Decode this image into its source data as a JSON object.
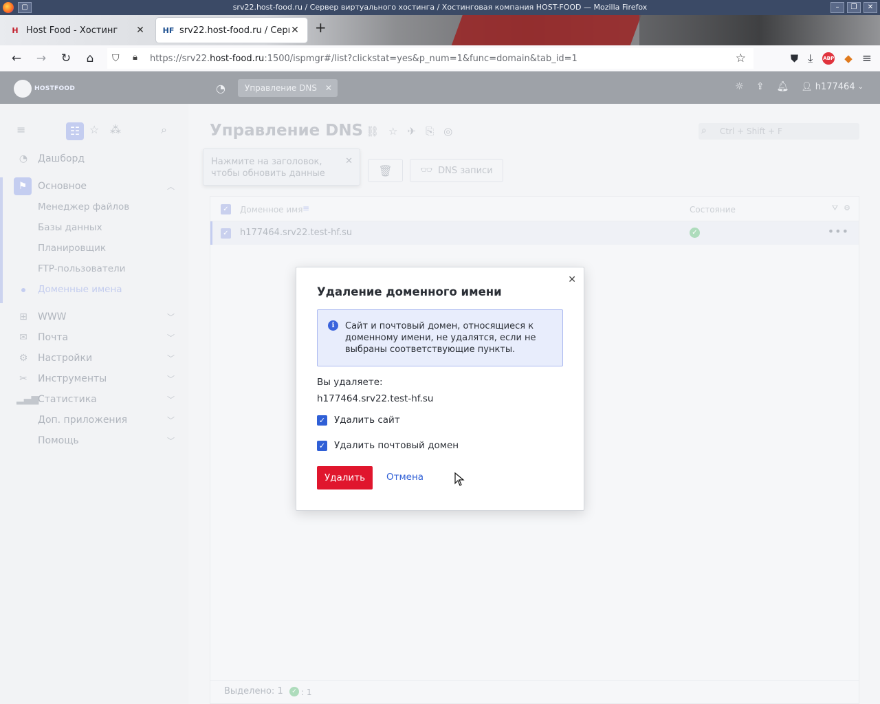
{
  "window": {
    "title": "srv22.host-food.ru / Сервер виртуального хостинга / Хостинговая компания HOST-FOOD — Mozilla Firefox"
  },
  "browser": {
    "tabs": [
      {
        "label": "Host Food - Хостинг",
        "favicon": "hf-favicon",
        "active": false
      },
      {
        "label": "srv22.host-food.ru / Сервер",
        "favicon": "hf-favicon",
        "active": true
      }
    ],
    "url": {
      "prefix": "https://srv22.",
      "domain": "host-food.ru",
      "suffix": ":1500/ispmgr#/list?clickstat=yes&p_num=1&func=domain&tab_id=1"
    },
    "icons": [
      "back-icon",
      "forward-icon",
      "reload-icon",
      "home-icon",
      "shield-icon",
      "lock-icon",
      "bookmark-star-icon",
      "pocket-icon",
      "downloads-icon",
      "adblock-icon",
      "extension-icon",
      "menu-icon"
    ],
    "adblock_label": "ABP"
  },
  "app_header": {
    "logo_text": "HOSTFOOD",
    "chip_label": "Управление DNS",
    "username": "h177464",
    "icons": [
      "dashboard-icon",
      "sun-icon",
      "upload-icon",
      "bell-icon",
      "user-icon"
    ]
  },
  "sidebar": {
    "items": [
      {
        "label": "Дашборд",
        "icon": "dashboard-icon"
      },
      {
        "label": "Основное",
        "icon": "flag-icon",
        "expanded": true
      },
      {
        "label": "WWW",
        "icon": "www-icon"
      },
      {
        "label": "Почта",
        "icon": "mail-icon"
      },
      {
        "label": "Настройки",
        "icon": "settings-sliders-icon"
      },
      {
        "label": "Инструменты",
        "icon": "tools-icon"
      },
      {
        "label": "Статистика",
        "icon": "stats-icon"
      },
      {
        "label": "Доп. приложения",
        "icon": ""
      },
      {
        "label": "Помощь",
        "icon": ""
      }
    ],
    "sub_items": [
      {
        "label": "Менеджер файлов"
      },
      {
        "label": "Базы данных"
      },
      {
        "label": "Планировщик"
      },
      {
        "label": "FTP-пользователи"
      },
      {
        "label": "Доменные имена",
        "active": true
      }
    ]
  },
  "main": {
    "title": "Управление DNS",
    "search_placeholder": "Ctrl + Shift + F",
    "tooltip": "Нажмите на заголовок, чтобы обновить данные",
    "dns_records_button": "DNS записи",
    "columns": [
      "Доменное имя",
      "Состояние"
    ],
    "rows": [
      {
        "domain": "h177464.srv22.test-hf.su",
        "status": "ok"
      }
    ],
    "footer_selected": "Выделено: 1",
    "footer_ok_count": ": 1"
  },
  "modal": {
    "title": "Удаление доменного имени",
    "info_text": "Сайт и почтовый домен, относящиеся к доменному имени, не удалятся, если не выбраны соответствующие пункты.",
    "deleting_label": "Вы удаляете:",
    "domain": "h177464.srv22.test-hf.su",
    "checkboxes": [
      {
        "label": "Удалить сайт",
        "checked": true
      },
      {
        "label": "Удалить почтовый домен",
        "checked": true
      }
    ],
    "delete_button": "Удалить",
    "cancel_button": "Отмена"
  },
  "colors": {
    "accent": "#2f5fd6",
    "danger": "#e0162d",
    "success": "#3cb66a"
  }
}
